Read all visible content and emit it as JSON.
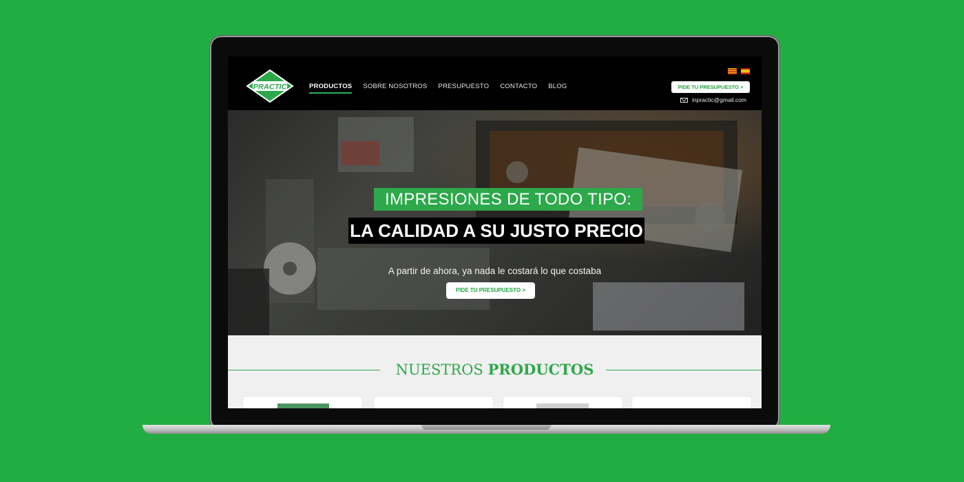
{
  "colors": {
    "background": "#22ad43",
    "brand_green": "#2da84a",
    "header_bg": "#000000"
  },
  "logo": {
    "text": "PRACTIC"
  },
  "nav": {
    "items": [
      {
        "label": "PRODUCTOS",
        "active": true
      },
      {
        "label": "SOBRE NOSOTROS",
        "active": false
      },
      {
        "label": "PRESUPUESTO",
        "active": false
      },
      {
        "label": "CONTACTO",
        "active": false
      },
      {
        "label": "BLOG",
        "active": false
      }
    ]
  },
  "header": {
    "languages": [
      "catalan-flag-icon",
      "spain-flag-icon"
    ],
    "cta_label": "PIDE TU PRESUPUESTO >",
    "email": "inpractic@gmail.com"
  },
  "hero": {
    "title_line1": "IMPRESIONES DE TODO TIPO:",
    "title_line2": "LA CALIDAD A SU JUSTO PRECIO",
    "subtitle": "A partir de ahora, ya nada le costará lo que costaba",
    "cta_label": "PIDE TU PRESUPUESTO >"
  },
  "products": {
    "heading_light": "NUESTROS ",
    "heading_bold": "PRODUCTOS"
  }
}
